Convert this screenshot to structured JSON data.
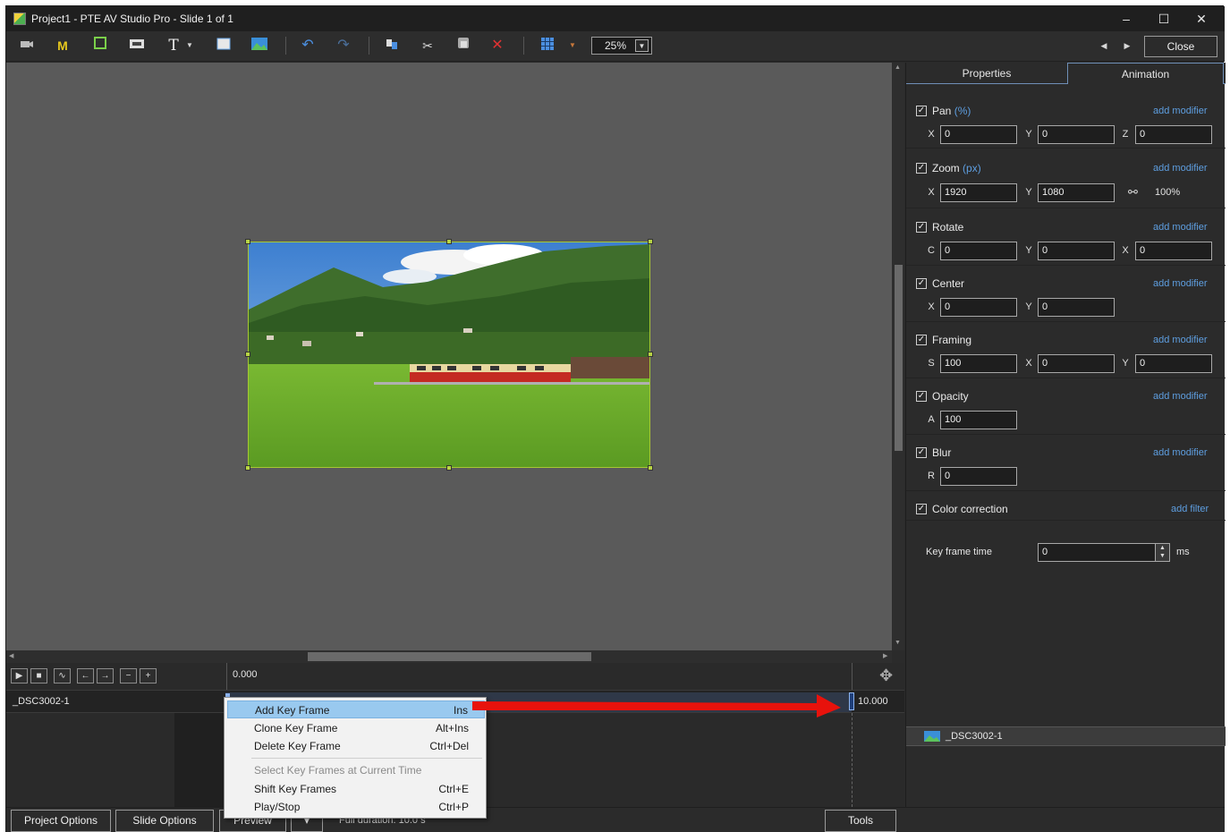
{
  "window": {
    "title": "Project1 - PTE AV Studio Pro - Slide 1 of 1",
    "controls": {
      "minimize": "–",
      "maximize": "☐",
      "close": "✕"
    }
  },
  "toolbar": {
    "zoom": "25%",
    "close_label": "Close",
    "icons": [
      "camera-icon",
      "mask-icon",
      "frame-icon",
      "video-icon",
      "text-icon",
      "text-dropdown-icon",
      "rectangle-icon",
      "image-icon",
      "undo-icon",
      "redo-icon",
      "copy-icon",
      "cut-icon",
      "paste-icon",
      "delete-icon",
      "grid-icon",
      "grid-dropdown-icon"
    ],
    "colors": {
      "mask": "#e6c81e",
      "frame": "#7bd04a",
      "delete": "#e03232",
      "undo": "#4b8fe0",
      "grid": "#4b8fe0"
    }
  },
  "tabs": {
    "properties": "Properties",
    "animation": "Animation",
    "active": "animation"
  },
  "sections": {
    "pan": {
      "title": "Pan",
      "unit": "(%)",
      "modifier": "add modifier",
      "x_label": "X",
      "x": "0",
      "y_label": "Y",
      "y": "0",
      "z_label": "Z",
      "z": "0"
    },
    "zoom": {
      "title": "Zoom",
      "unit": "(px)",
      "modifier": "add modifier",
      "x_label": "X",
      "x": "1920",
      "y_label": "Y",
      "y": "1080",
      "percent": "100%"
    },
    "rotate": {
      "title": "Rotate",
      "modifier": "add modifier",
      "c_label": "C",
      "c": "0",
      "y_label": "Y",
      "y": "0",
      "x_label": "X",
      "x": "0"
    },
    "center": {
      "title": "Center",
      "modifier": "add modifier",
      "x_label": "X",
      "x": "0",
      "y_label": "Y",
      "y": "0"
    },
    "framing": {
      "title": "Framing",
      "modifier": "add modifier",
      "s_label": "S",
      "s": "100",
      "x_label": "X",
      "x": "0",
      "y_label": "Y",
      "y": "0"
    },
    "opacity": {
      "title": "Opacity",
      "modifier": "add modifier",
      "a_label": "A",
      "a": "100"
    },
    "blur": {
      "title": "Blur",
      "modifier": "add modifier",
      "r_label": "R",
      "r": "0"
    },
    "color_correction": {
      "title": "Color correction",
      "filter": "add filter"
    }
  },
  "keyframe_time": {
    "label": "Key frame time",
    "value": "0",
    "unit": "ms"
  },
  "object_list": {
    "item": "_DSC3002-1"
  },
  "timeline": {
    "start_time": "0.000",
    "track_name": "_DSC3002-1",
    "end_time": "10.000",
    "controls": [
      "play-icon",
      "stop-icon",
      "waveform-icon",
      "prev-keyframe-icon",
      "next-keyframe-icon",
      "zoom-out-icon",
      "zoom-in-icon"
    ]
  },
  "context_menu": {
    "items": [
      {
        "label": "Add Key Frame",
        "shortcut": "Ins",
        "highlighted": true
      },
      {
        "label": "Clone Key Frame",
        "shortcut": "Alt+Ins"
      },
      {
        "label": "Delete Key Frame",
        "shortcut": "Ctrl+Del"
      },
      {
        "label": "Select Key Frames at Current Time",
        "shortcut": "",
        "disabled": true
      },
      {
        "label": "Shift Key Frames",
        "shortcut": "Ctrl+E"
      },
      {
        "label": "Play/Stop",
        "shortcut": "Ctrl+P"
      }
    ]
  },
  "bottom": {
    "project_options": "Project Options",
    "slide_options": "Slide Options",
    "preview": "Preview",
    "full_duration": "Full duration: 10.0 s",
    "tools": "Tools"
  },
  "annotation": {
    "arrow_color": "#e8120c"
  }
}
